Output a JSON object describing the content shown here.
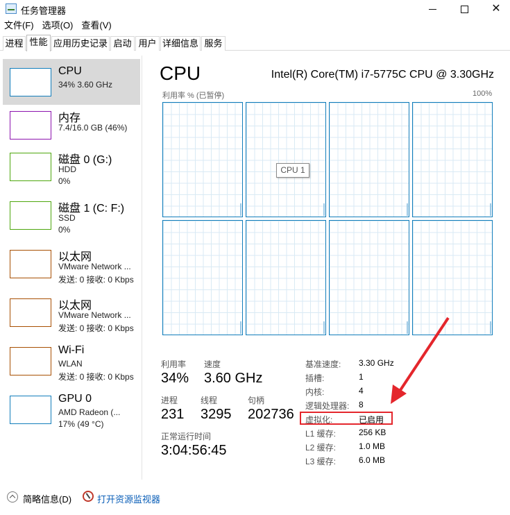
{
  "window": {
    "title": "任务管理器",
    "minimize_icon": "minimize-icon",
    "maximize_icon": "maximize-icon",
    "close_icon": "close-icon",
    "close_glyph": "✕"
  },
  "menu": {
    "items": [
      "文件(F)",
      "选项(O)",
      "查看(V)"
    ]
  },
  "tabs": {
    "items": [
      "进程",
      "性能",
      "应用历史记录",
      "启动",
      "用户",
      "详细信息",
      "服务"
    ],
    "active": "性能"
  },
  "resources": [
    {
      "title": "CPU",
      "line1": "34% 3.60 GHz",
      "line2": "",
      "color": "#117dbb"
    },
    {
      "title": "内存",
      "line1": "7.4/16.0 GB (46%)",
      "line2": "",
      "color": "#8b12ae"
    },
    {
      "title": "磁盘 0 (G:)",
      "line1": "HDD",
      "line2": "0%",
      "color": "#4da60c"
    },
    {
      "title": "磁盘 1 (C: F:)",
      "line1": "SSD",
      "line2": "0%",
      "color": "#4da60c"
    },
    {
      "title": "以太网",
      "line1": "VMware Network ...",
      "line2": "发送: 0 接收: 0 Kbps",
      "color": "#a74f01"
    },
    {
      "title": "以太网",
      "line1": "VMware Network ...",
      "line2": "发送: 0 接收: 0 Kbps",
      "color": "#a74f01"
    },
    {
      "title": "Wi-Fi",
      "line1": "WLAN",
      "line2": "发送: 0 接收: 0 Kbps",
      "color": "#a74f01"
    },
    {
      "title": "GPU 0",
      "line1": "AMD Radeon (...",
      "line2": "17% (49 °C)",
      "color": "#117dbb"
    }
  ],
  "main": {
    "title": "CPU",
    "model": "Intel(R) Core(TM) i7-5775C CPU @ 3.30GHz",
    "graph_caption": "利用率 % (已暂停)",
    "graph_max": "100%",
    "graph_count": 8,
    "graph_color": "#117dbb",
    "tooltip": "CPU 1"
  },
  "stats": {
    "utilization_label": "利用率",
    "utilization_value": "34%",
    "speed_label": "速度",
    "speed_value": "3.60 GHz",
    "processes_label": "进程",
    "processes_value": "231",
    "threads_label": "线程",
    "threads_value": "3295",
    "handles_label": "句柄",
    "handles_value": "202736",
    "uptime_label": "正常运行时间",
    "uptime_value": "3:04:56:45"
  },
  "specs": [
    {
      "label": "基准速度:",
      "value": "3.30 GHz"
    },
    {
      "label": "插槽:",
      "value": "1"
    },
    {
      "label": "内核:",
      "value": "4"
    },
    {
      "label": "逻辑处理器:",
      "value": "8"
    },
    {
      "label": "虚拟化:",
      "value": "已启用"
    },
    {
      "label": "L1 缓存:",
      "value": "256 KB"
    },
    {
      "label": "L2 缓存:",
      "value": "1.0 MB"
    },
    {
      "label": "L3 缓存:",
      "value": "6.0 MB"
    }
  ],
  "annotation": {
    "color": "#e4262c"
  },
  "footer": {
    "collapse_label": "简略信息(D)",
    "monitor_label": "打开资源监视器",
    "link_color": "#0b5fb8"
  }
}
